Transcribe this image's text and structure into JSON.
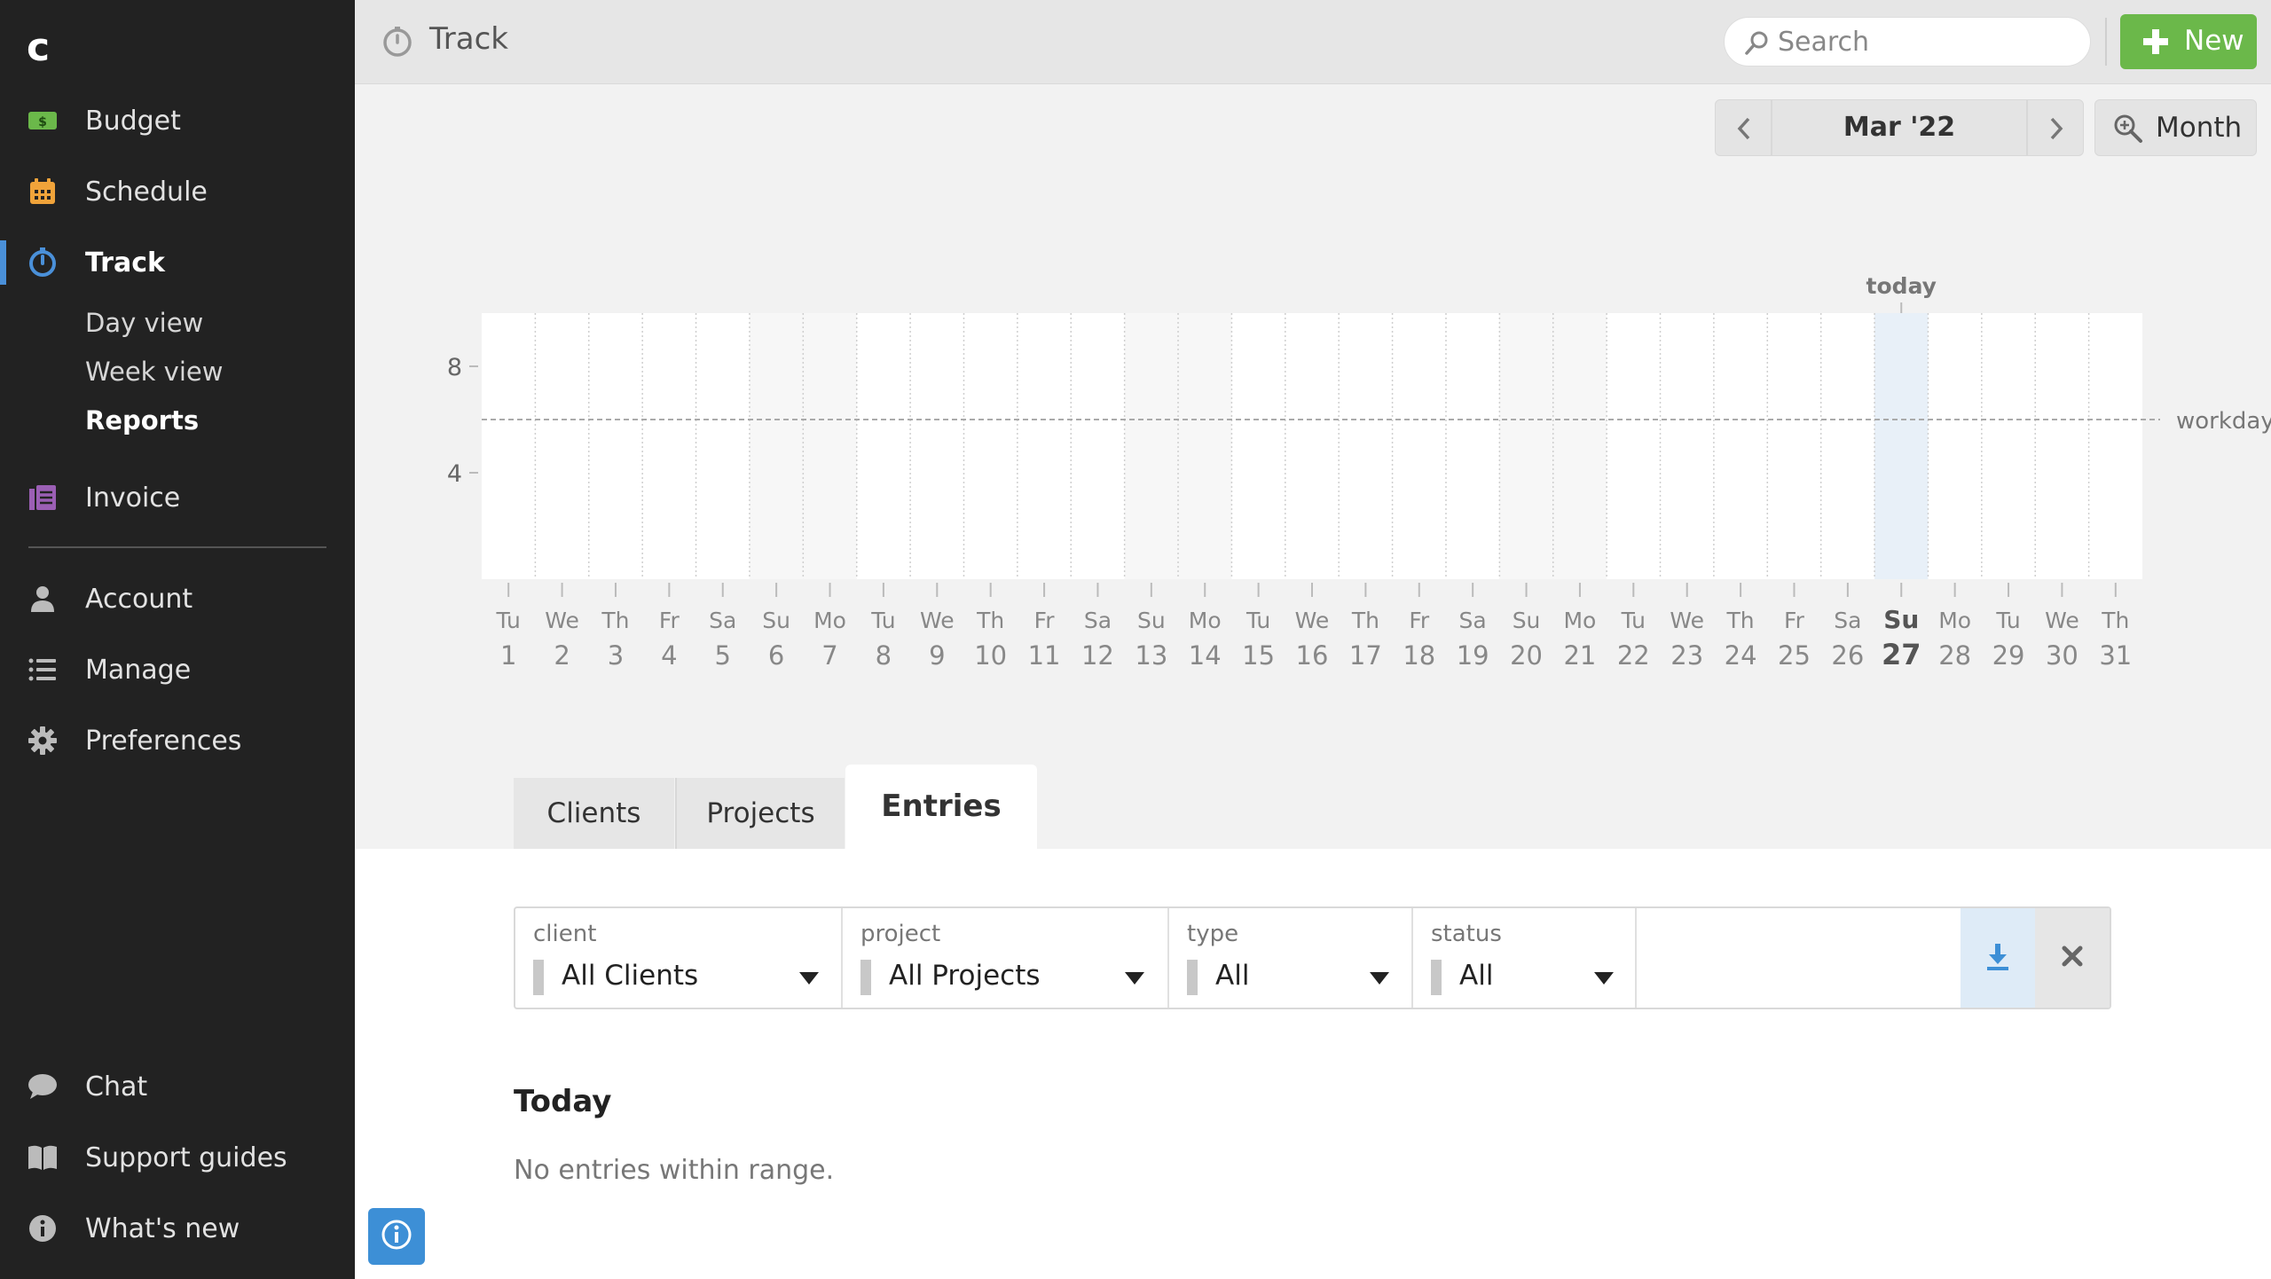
{
  "sidebar": {
    "logo": "c",
    "items": [
      {
        "label": "Budget"
      },
      {
        "label": "Schedule"
      },
      {
        "label": "Track"
      },
      {
        "label": "Invoice"
      },
      {
        "label": "Account"
      },
      {
        "label": "Manage"
      },
      {
        "label": "Preferences"
      }
    ],
    "track_sub": [
      "Day view",
      "Week view",
      "Reports"
    ],
    "bottom": [
      {
        "label": "Chat"
      },
      {
        "label": "Support guides"
      },
      {
        "label": "What's new"
      }
    ]
  },
  "header": {
    "title": "Track",
    "search_placeholder": "Search",
    "new_label": "New"
  },
  "period": {
    "label": "Mar '22",
    "zoom_label": "Month"
  },
  "chart_data": {
    "type": "bar",
    "today_label": "today",
    "workday_label": "workday",
    "workday_value": 6,
    "ylim": [
      0,
      10
    ],
    "yticks": [
      8,
      4
    ],
    "today_index": 26,
    "weekend_days": [
      5,
      6,
      12,
      13,
      19,
      20,
      26
    ],
    "days": [
      {
        "dow": "Tu",
        "day": "1"
      },
      {
        "dow": "We",
        "day": "2"
      },
      {
        "dow": "Th",
        "day": "3"
      },
      {
        "dow": "Fr",
        "day": "4"
      },
      {
        "dow": "Sa",
        "day": "5"
      },
      {
        "dow": "Su",
        "day": "6"
      },
      {
        "dow": "Mo",
        "day": "7"
      },
      {
        "dow": "Tu",
        "day": "8"
      },
      {
        "dow": "We",
        "day": "9"
      },
      {
        "dow": "Th",
        "day": "10"
      },
      {
        "dow": "Fr",
        "day": "11"
      },
      {
        "dow": "Sa",
        "day": "12"
      },
      {
        "dow": "Su",
        "day": "13"
      },
      {
        "dow": "Mo",
        "day": "14"
      },
      {
        "dow": "Tu",
        "day": "15"
      },
      {
        "dow": "We",
        "day": "16"
      },
      {
        "dow": "Th",
        "day": "17"
      },
      {
        "dow": "Fr",
        "day": "18"
      },
      {
        "dow": "Sa",
        "day": "19"
      },
      {
        "dow": "Su",
        "day": "20"
      },
      {
        "dow": "Mo",
        "day": "21"
      },
      {
        "dow": "Tu",
        "day": "22"
      },
      {
        "dow": "We",
        "day": "23"
      },
      {
        "dow": "Th",
        "day": "24"
      },
      {
        "dow": "Fr",
        "day": "25"
      },
      {
        "dow": "Sa",
        "day": "26"
      },
      {
        "dow": "Su",
        "day": "27"
      },
      {
        "dow": "Mo",
        "day": "28"
      },
      {
        "dow": "Tu",
        "day": "29"
      },
      {
        "dow": "We",
        "day": "30"
      },
      {
        "dow": "Th",
        "day": "31"
      }
    ],
    "values": [
      0,
      0,
      0,
      0,
      0,
      0,
      0,
      0,
      0,
      0,
      0,
      0,
      0,
      0,
      0,
      0,
      0,
      0,
      0,
      0,
      0,
      0,
      0,
      0,
      0,
      0,
      0,
      0,
      0,
      0,
      0
    ]
  },
  "tabs": [
    {
      "label": "Clients"
    },
    {
      "label": "Projects"
    },
    {
      "label": "Entries"
    }
  ],
  "filters": {
    "client": {
      "label": "client",
      "value": "All Clients"
    },
    "project": {
      "label": "project",
      "value": "All Projects"
    },
    "type": {
      "label": "type",
      "value": "All"
    },
    "status": {
      "label": "status",
      "value": "All"
    }
  },
  "entries": {
    "section_title": "Today",
    "empty_message": "No entries within range."
  },
  "colors": {
    "accent": "#4a90d9",
    "new_button": "#6bb84a",
    "sidebar": "#222222"
  }
}
